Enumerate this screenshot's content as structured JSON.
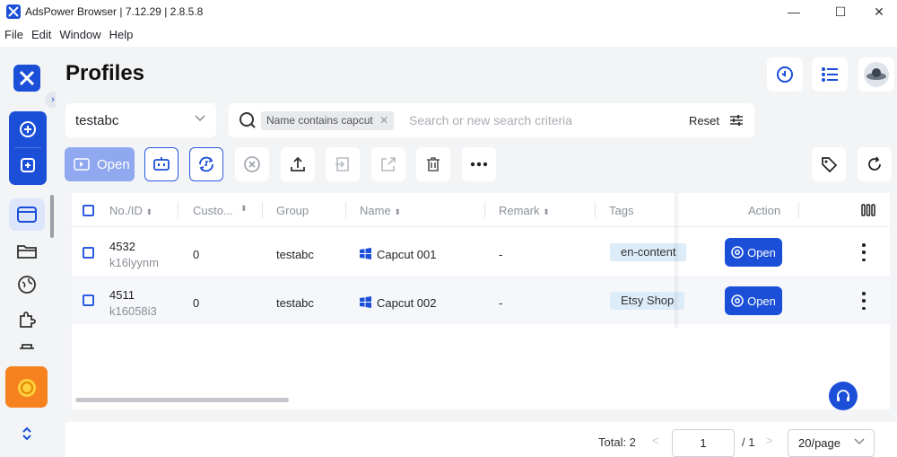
{
  "window": {
    "title": "AdsPower Browser | 7.12.29 | 2.8.5.8",
    "minimize": "—",
    "maximize": "☐",
    "close": "✕"
  },
  "menu": [
    "File",
    "Edit",
    "Window",
    "Help"
  ],
  "page": {
    "title": "Profiles"
  },
  "group_select": {
    "value": "testabc"
  },
  "search": {
    "chip": "Name contains capcut",
    "chip_close": "✕",
    "placeholder": "Search or new search criteria",
    "reset": "Reset"
  },
  "toolbar": {
    "open_label": "Open"
  },
  "table": {
    "columns": [
      "No./ID",
      "Custo...",
      "Group",
      "Name",
      "Remark",
      "Tags",
      "Action"
    ],
    "rows": [
      {
        "no": "4532",
        "id": "k16lyynm",
        "custom": "0",
        "group": "testabc",
        "name": "Capcut 001",
        "remark": "-",
        "tag": "en-content",
        "action": "Open"
      },
      {
        "no": "4511",
        "id": "k16058i3",
        "custom": "0",
        "group": "testabc",
        "name": "Capcut 002",
        "remark": "-",
        "tag": "Etsy Shop",
        "action": "Open"
      }
    ]
  },
  "footer": {
    "total": "Total: 2",
    "prev": "<",
    "page": "1",
    "of": "/ 1",
    "next": ">",
    "per_page": "20/page"
  },
  "colors": {
    "accent": "#1b4fd8",
    "tag_bg": "#dcecf8",
    "coin": "#f6821f"
  }
}
